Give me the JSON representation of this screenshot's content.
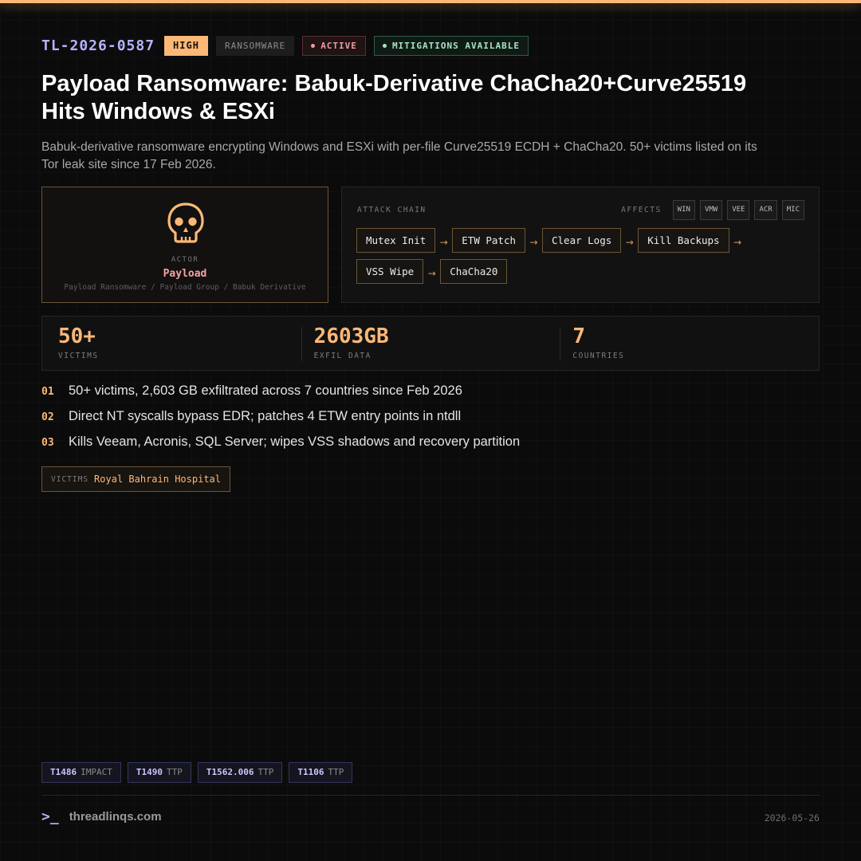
{
  "report": {
    "id": "TL-2026-0587",
    "severity": "HIGH",
    "category": "RANSOMWARE",
    "status": "ACTIVE",
    "mitigation": "MITIGATIONS AVAILABLE",
    "title": "Payload Ransomware: Babuk-Derivative ChaCha20+Curve25519 Hits Windows & ESXi",
    "summary": "Babuk-derivative ransomware encrypting Windows and ESXi with per-file Curve25519 ECDH + ChaCha20. 50+ victims listed on its Tor leak site since 17 Feb 2026."
  },
  "actor": {
    "label": "ACTOR",
    "name": "Payload",
    "aliases": "Payload Ransomware / Payload Group / Babuk Derivative",
    "icon": "skull-icon"
  },
  "attack_chain": {
    "title": "ATTACK CHAIN",
    "affects_label": "AFFECTS",
    "affects": [
      "WIN",
      "VMW",
      "VEE",
      "ACR",
      "MIC"
    ],
    "steps": [
      "Mutex Init",
      "ETW Patch",
      "Clear Logs",
      "Kill Backups",
      "VSS Wipe",
      "ChaCha20"
    ],
    "arrow": "→"
  },
  "stats": [
    {
      "value": "50+",
      "label": "VICTIMS"
    },
    {
      "value": "2603GB",
      "label": "EXFIL DATA"
    },
    {
      "value": "7",
      "label": "COUNTRIES"
    }
  ],
  "findings": [
    {
      "num": "01",
      "text": "50+ victims, 2,603 GB exfiltrated across 7 countries since Feb 2026"
    },
    {
      "num": "02",
      "text": "Direct NT syscalls bypass EDR; patches 4 ETW entry points in ntdll"
    },
    {
      "num": "03",
      "text": "Kills Veeam, Acronis, SQL Server; wipes VSS shadows and recovery partition"
    }
  ],
  "victims": {
    "label": "VICTIMS",
    "value": "Royal Bahrain Hospital"
  },
  "ttps": [
    {
      "id": "T1486",
      "kind": "IMPACT"
    },
    {
      "id": "T1490",
      "kind": "TTP"
    },
    {
      "id": "T1562.006",
      "kind": "TTP"
    },
    {
      "id": "T1106",
      "kind": "TTP"
    }
  ],
  "footer": {
    "prompt": ">_",
    "brand": "threadlinqs.com",
    "date": "2026-05-26"
  },
  "colors": {
    "accent": "#fdb877",
    "id_purple": "#b6b3ff",
    "active_red": "#f39aa0",
    "mitigation_green": "#a6e3c2",
    "background": "#0b0b0b"
  }
}
